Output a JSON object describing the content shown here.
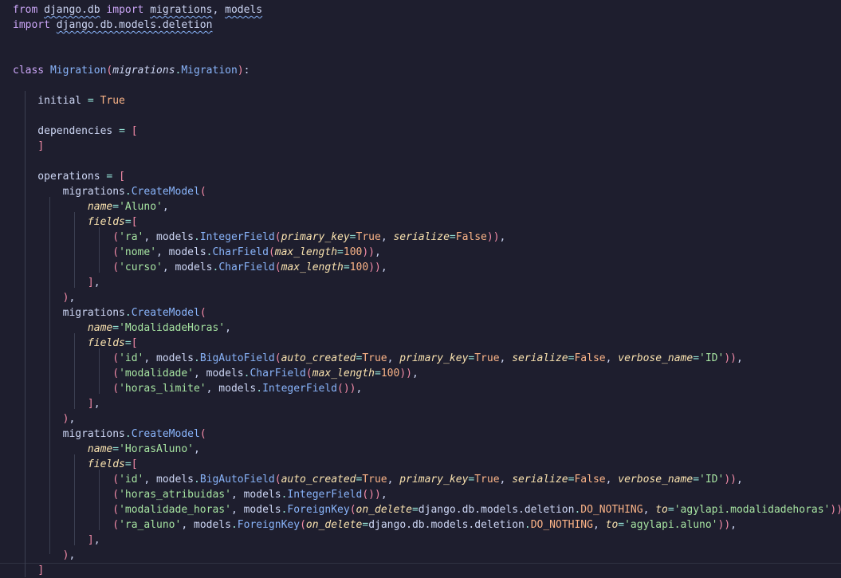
{
  "editor": {
    "background": "#1e1e2e",
    "theme_colors": {
      "keyword": "#cba6f7",
      "function": "#89b4fa",
      "string": "#a6e3a1",
      "param": "#f9e2af",
      "number": "#fab387",
      "operator": "#94e2d5",
      "bracket": "#f38ba8",
      "identifier": "#cdd6f4"
    },
    "lines": [
      [
        [
          "kw",
          "from"
        ],
        [
          "id",
          " "
        ],
        [
          "sq",
          "django.db"
        ],
        [
          "id",
          " "
        ],
        [
          "kw",
          "import"
        ],
        [
          "id",
          " "
        ],
        [
          "sq",
          "migrations"
        ],
        [
          "id",
          ", "
        ],
        [
          "sq",
          "models"
        ]
      ],
      [
        [
          "kw",
          "import"
        ],
        [
          "id",
          " "
        ],
        [
          "sq",
          "django.db.models.deletion"
        ]
      ],
      [],
      [],
      [
        [
          "kw",
          "class"
        ],
        [
          "id",
          " "
        ],
        [
          "fn",
          "Migration"
        ],
        [
          "br",
          "("
        ],
        [
          "it",
          "migrations"
        ],
        [
          "pun",
          "."
        ],
        [
          "fn",
          "Migration"
        ],
        [
          "br",
          ")"
        ],
        [
          "id",
          ":"
        ]
      ],
      [],
      [
        [
          "id",
          "    initial "
        ],
        [
          "pun",
          "="
        ],
        [
          "id",
          " "
        ],
        [
          "num",
          "True"
        ]
      ],
      [],
      [
        [
          "id",
          "    dependencies "
        ],
        [
          "pun",
          "="
        ],
        [
          "id",
          " "
        ],
        [
          "br",
          "["
        ]
      ],
      [
        [
          "id",
          "    "
        ],
        [
          "br",
          "]"
        ]
      ],
      [],
      [
        [
          "id",
          "    operations "
        ],
        [
          "pun",
          "="
        ],
        [
          "id",
          " "
        ],
        [
          "br",
          "["
        ]
      ],
      [
        [
          "id",
          "        migrations"
        ],
        [
          "pun",
          "."
        ],
        [
          "fn",
          "CreateModel"
        ],
        [
          "br",
          "("
        ]
      ],
      [
        [
          "id",
          "            "
        ],
        [
          "prm",
          "name"
        ],
        [
          "pun",
          "="
        ],
        [
          "str",
          "'Aluno'"
        ],
        [
          "id",
          ","
        ]
      ],
      [
        [
          "id",
          "            "
        ],
        [
          "prm",
          "fields"
        ],
        [
          "pun",
          "="
        ],
        [
          "br",
          "["
        ]
      ],
      [
        [
          "id",
          "                "
        ],
        [
          "br",
          "("
        ],
        [
          "str",
          "'ra'"
        ],
        [
          "id",
          ", models"
        ],
        [
          "pun",
          "."
        ],
        [
          "fn",
          "IntegerField"
        ],
        [
          "br",
          "("
        ],
        [
          "prm",
          "primary_key"
        ],
        [
          "pun",
          "="
        ],
        [
          "num",
          "True"
        ],
        [
          "id",
          ", "
        ],
        [
          "prm",
          "serialize"
        ],
        [
          "pun",
          "="
        ],
        [
          "num",
          "False"
        ],
        [
          "br",
          "))"
        ],
        [
          "id",
          ","
        ]
      ],
      [
        [
          "id",
          "                "
        ],
        [
          "br",
          "("
        ],
        [
          "str",
          "'nome'"
        ],
        [
          "id",
          ", models"
        ],
        [
          "pun",
          "."
        ],
        [
          "fn",
          "CharField"
        ],
        [
          "br",
          "("
        ],
        [
          "prm",
          "max_length"
        ],
        [
          "pun",
          "="
        ],
        [
          "num",
          "100"
        ],
        [
          "br",
          "))"
        ],
        [
          "id",
          ","
        ]
      ],
      [
        [
          "id",
          "                "
        ],
        [
          "br",
          "("
        ],
        [
          "str",
          "'curso'"
        ],
        [
          "id",
          ", models"
        ],
        [
          "pun",
          "."
        ],
        [
          "fn",
          "CharField"
        ],
        [
          "br",
          "("
        ],
        [
          "prm",
          "max_length"
        ],
        [
          "pun",
          "="
        ],
        [
          "num",
          "100"
        ],
        [
          "br",
          "))"
        ],
        [
          "id",
          ","
        ]
      ],
      [
        [
          "id",
          "            "
        ],
        [
          "br",
          "]"
        ],
        [
          "id",
          ","
        ]
      ],
      [
        [
          "id",
          "        "
        ],
        [
          "br",
          ")"
        ],
        [
          "id",
          ","
        ]
      ],
      [
        [
          "id",
          "        migrations"
        ],
        [
          "pun",
          "."
        ],
        [
          "fn",
          "CreateModel"
        ],
        [
          "br",
          "("
        ]
      ],
      [
        [
          "id",
          "            "
        ],
        [
          "prm",
          "name"
        ],
        [
          "pun",
          "="
        ],
        [
          "str",
          "'ModalidadeHoras'"
        ],
        [
          "id",
          ","
        ]
      ],
      [
        [
          "id",
          "            "
        ],
        [
          "prm",
          "fields"
        ],
        [
          "pun",
          "="
        ],
        [
          "br",
          "["
        ]
      ],
      [
        [
          "id",
          "                "
        ],
        [
          "br",
          "("
        ],
        [
          "str",
          "'id'"
        ],
        [
          "id",
          ", models"
        ],
        [
          "pun",
          "."
        ],
        [
          "fn",
          "BigAutoField"
        ],
        [
          "br",
          "("
        ],
        [
          "prm",
          "auto_created"
        ],
        [
          "pun",
          "="
        ],
        [
          "num",
          "True"
        ],
        [
          "id",
          ", "
        ],
        [
          "prm",
          "primary_key"
        ],
        [
          "pun",
          "="
        ],
        [
          "num",
          "True"
        ],
        [
          "id",
          ", "
        ],
        [
          "prm",
          "serialize"
        ],
        [
          "pun",
          "="
        ],
        [
          "num",
          "False"
        ],
        [
          "id",
          ", "
        ],
        [
          "prm",
          "verbose_name"
        ],
        [
          "pun",
          "="
        ],
        [
          "str",
          "'ID'"
        ],
        [
          "br",
          "))"
        ],
        [
          "id",
          ","
        ]
      ],
      [
        [
          "id",
          "                "
        ],
        [
          "br",
          "("
        ],
        [
          "str",
          "'modalidade'"
        ],
        [
          "id",
          ", models"
        ],
        [
          "pun",
          "."
        ],
        [
          "fn",
          "CharField"
        ],
        [
          "br",
          "("
        ],
        [
          "prm",
          "max_length"
        ],
        [
          "pun",
          "="
        ],
        [
          "num",
          "100"
        ],
        [
          "br",
          "))"
        ],
        [
          "id",
          ","
        ]
      ],
      [
        [
          "id",
          "                "
        ],
        [
          "br",
          "("
        ],
        [
          "str",
          "'horas_limite'"
        ],
        [
          "id",
          ", models"
        ],
        [
          "pun",
          "."
        ],
        [
          "fn",
          "IntegerField"
        ],
        [
          "br",
          "())"
        ],
        [
          "id",
          ","
        ]
      ],
      [
        [
          "id",
          "            "
        ],
        [
          "br",
          "]"
        ],
        [
          "id",
          ","
        ]
      ],
      [
        [
          "id",
          "        "
        ],
        [
          "br",
          ")"
        ],
        [
          "id",
          ","
        ]
      ],
      [
        [
          "id",
          "        migrations"
        ],
        [
          "pun",
          "."
        ],
        [
          "fn",
          "CreateModel"
        ],
        [
          "br",
          "("
        ]
      ],
      [
        [
          "id",
          "            "
        ],
        [
          "prm",
          "name"
        ],
        [
          "pun",
          "="
        ],
        [
          "str",
          "'HorasAluno'"
        ],
        [
          "id",
          ","
        ]
      ],
      [
        [
          "id",
          "            "
        ],
        [
          "prm",
          "fields"
        ],
        [
          "pun",
          "="
        ],
        [
          "br",
          "["
        ]
      ],
      [
        [
          "id",
          "                "
        ],
        [
          "br",
          "("
        ],
        [
          "str",
          "'id'"
        ],
        [
          "id",
          ", models"
        ],
        [
          "pun",
          "."
        ],
        [
          "fn",
          "BigAutoField"
        ],
        [
          "br",
          "("
        ],
        [
          "prm",
          "auto_created"
        ],
        [
          "pun",
          "="
        ],
        [
          "num",
          "True"
        ],
        [
          "id",
          ", "
        ],
        [
          "prm",
          "primary_key"
        ],
        [
          "pun",
          "="
        ],
        [
          "num",
          "True"
        ],
        [
          "id",
          ", "
        ],
        [
          "prm",
          "serialize"
        ],
        [
          "pun",
          "="
        ],
        [
          "num",
          "False"
        ],
        [
          "id",
          ", "
        ],
        [
          "prm",
          "verbose_name"
        ],
        [
          "pun",
          "="
        ],
        [
          "str",
          "'ID'"
        ],
        [
          "br",
          "))"
        ],
        [
          "id",
          ","
        ]
      ],
      [
        [
          "id",
          "                "
        ],
        [
          "br",
          "("
        ],
        [
          "str",
          "'horas_atribuidas'"
        ],
        [
          "id",
          ", models"
        ],
        [
          "pun",
          "."
        ],
        [
          "fn",
          "IntegerField"
        ],
        [
          "br",
          "())"
        ],
        [
          "id",
          ","
        ]
      ],
      [
        [
          "id",
          "                "
        ],
        [
          "br",
          "("
        ],
        [
          "str",
          "'modalidade_horas'"
        ],
        [
          "id",
          ", models"
        ],
        [
          "pun",
          "."
        ],
        [
          "fn",
          "ForeignKey"
        ],
        [
          "br",
          "("
        ],
        [
          "prm",
          "on_delete"
        ],
        [
          "pun",
          "="
        ],
        [
          "id",
          "django.db.models.deletion"
        ],
        [
          "pun",
          "."
        ],
        [
          "num",
          "DO_NOTHING"
        ],
        [
          "id",
          ", "
        ],
        [
          "prm",
          "to"
        ],
        [
          "pun",
          "="
        ],
        [
          "str",
          "'agylapi.modalidadehoras'"
        ],
        [
          "br",
          "))"
        ],
        [
          "id",
          ","
        ]
      ],
      [
        [
          "id",
          "                "
        ],
        [
          "br",
          "("
        ],
        [
          "str",
          "'ra_aluno'"
        ],
        [
          "id",
          ", models"
        ],
        [
          "pun",
          "."
        ],
        [
          "fn",
          "ForeignKey"
        ],
        [
          "br",
          "("
        ],
        [
          "prm",
          "on_delete"
        ],
        [
          "pun",
          "="
        ],
        [
          "id",
          "django.db.models.deletion"
        ],
        [
          "pun",
          "."
        ],
        [
          "num",
          "DO_NOTHING"
        ],
        [
          "id",
          ", "
        ],
        [
          "prm",
          "to"
        ],
        [
          "pun",
          "="
        ],
        [
          "str",
          "'agylapi.aluno'"
        ],
        [
          "br",
          "))"
        ],
        [
          "id",
          ","
        ]
      ],
      [
        [
          "id",
          "            "
        ],
        [
          "br",
          "]"
        ],
        [
          "id",
          ","
        ]
      ],
      [
        [
          "id",
          "        "
        ],
        [
          "br",
          ")"
        ],
        [
          "id",
          ","
        ]
      ],
      [
        [
          "id",
          "    "
        ],
        [
          "br",
          "]"
        ]
      ]
    ]
  }
}
